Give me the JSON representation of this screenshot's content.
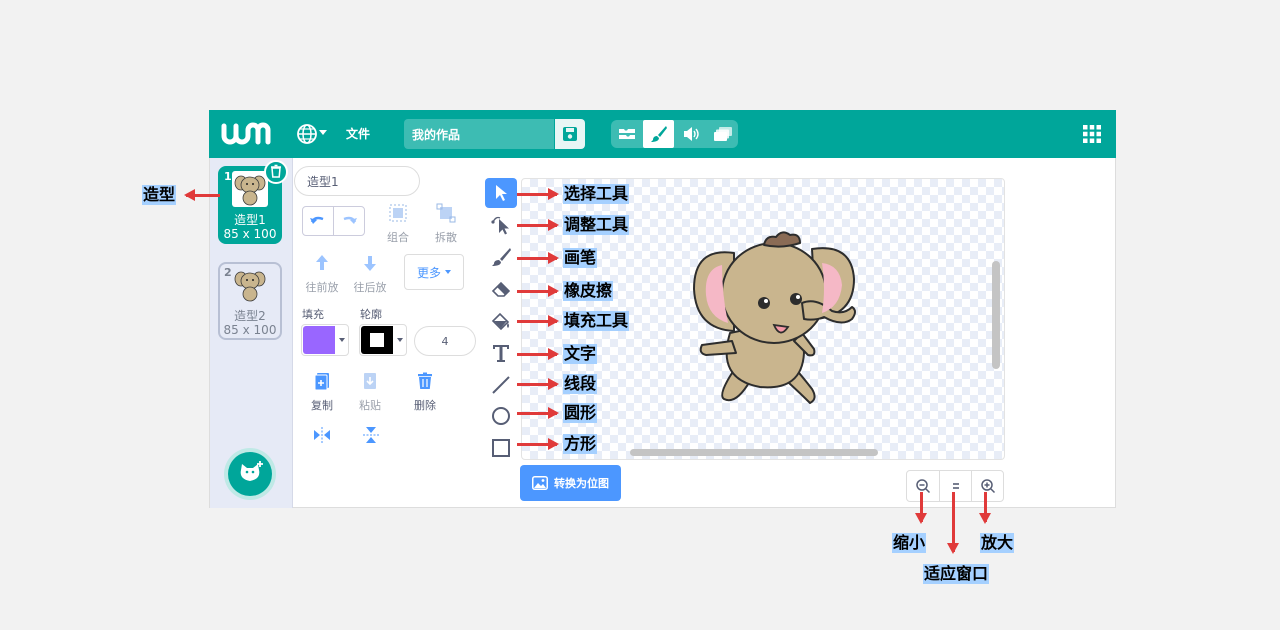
{
  "header": {
    "file_menu": "文件",
    "project_title": "我的作品",
    "modes": [
      {
        "icon": "blocks-icon",
        "active": false
      },
      {
        "icon": "paint-brush-icon",
        "active": true
      },
      {
        "icon": "sound-icon",
        "active": false
      },
      {
        "icon": "stacked-cards-icon",
        "active": false
      }
    ]
  },
  "costumes": [
    {
      "index": "1",
      "name": "造型1",
      "size": "85 x 100",
      "selected": true
    },
    {
      "index": "2",
      "name": "造型2",
      "size": "85 x 100",
      "selected": false
    }
  ],
  "editor": {
    "costume_name": "造型1",
    "group_label": "组合",
    "ungroup_label": "拆散",
    "forward_label": "往前放",
    "backward_label": "往后放",
    "more_label": "更多",
    "fill_label": "填充",
    "outline_label": "轮廓",
    "fill_color": "#9966ff",
    "outline_color": "#000000",
    "stroke_width": "4",
    "copy_label": "复制",
    "paste_label": "粘贴",
    "delete_label": "删除",
    "convert_bitmap_label": "转换为位图"
  },
  "tools": [
    {
      "icon": "select-arrow-icon",
      "annotation": "选择工具",
      "active": true
    },
    {
      "icon": "reshape-icon",
      "annotation": "调整工具"
    },
    {
      "icon": "brush-icon",
      "annotation": "画笔"
    },
    {
      "icon": "eraser-icon",
      "annotation": "橡皮擦"
    },
    {
      "icon": "fill-bucket-icon",
      "annotation": "填充工具"
    },
    {
      "icon": "text-icon",
      "annotation": "文字"
    },
    {
      "icon": "line-icon",
      "annotation": "线段"
    },
    {
      "icon": "circle-icon",
      "annotation": "圆形"
    },
    {
      "icon": "rectangle-icon",
      "annotation": "方形"
    }
  ],
  "annotations": {
    "costume": "造型",
    "zoom_out": "缩小",
    "zoom_reset": "适应窗口",
    "zoom_in": "放大"
  },
  "colors": {
    "brand": "#00a69a",
    "accent": "#4c97ff",
    "annotation_arrow": "#e03a3a",
    "annotation_highlight": "#a5d0ff"
  }
}
